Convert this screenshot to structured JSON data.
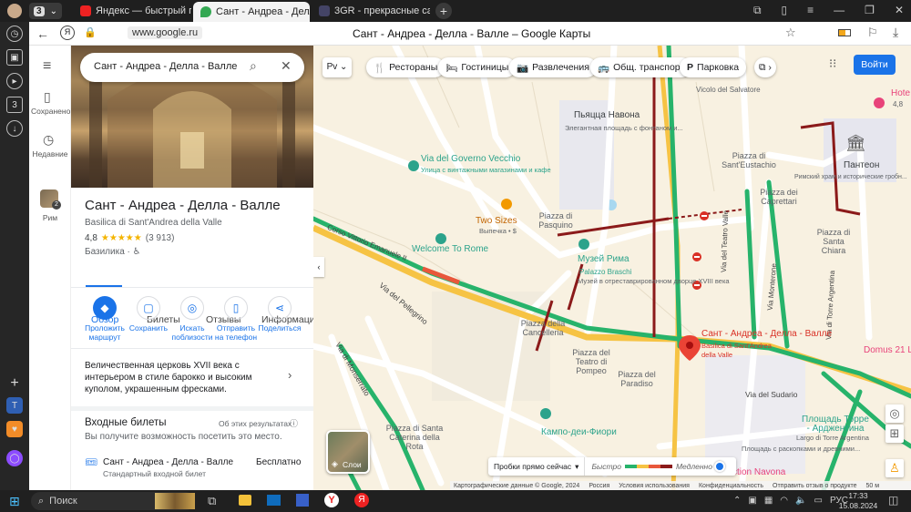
{
  "browser": {
    "tabs": [
      {
        "label": "Яндекс — быстрый поиск"
      },
      {
        "label": "Сант - Андреа - Делла"
      },
      {
        "label": "3GR - прекрасные сады, н"
      }
    ],
    "tab_counter": "3",
    "url": "www.google.ru",
    "page_title": "Сант - Андреа - Делла - Валле – Google Карты"
  },
  "sidebar": {
    "saved_label": "Сохранено",
    "recent_label": "Недавние",
    "rome_label": "Рим",
    "rome_badge": "2"
  },
  "search": {
    "value": "Сант - Андреа - Делла - Валле"
  },
  "place": {
    "title": "Сант - Андреа - Делла - Валле",
    "subtitle": "Basilica di Sant'Andrea della Valle",
    "rating": "4,8",
    "stars": "★★★★★",
    "reviews": "(3 913)",
    "category": "Базилика · ♿",
    "tabs": [
      "Обзор",
      "Билеты",
      "Отзывы",
      "Информация"
    ],
    "actions": [
      {
        "label": "Проложить маршрут",
        "icon": "◆"
      },
      {
        "label": "Сохранить",
        "icon": "▢"
      },
      {
        "label": "Искать поблизости",
        "icon": "◎"
      },
      {
        "label": "Отправить на телефон",
        "icon": "▯"
      },
      {
        "label": "Поделиться",
        "icon": "⋖"
      }
    ],
    "description": "Величественная церковь XVII века с интерьером в стиле барокко и высоким куполом, украшенным фресками.",
    "tickets_title": "Входные билеты",
    "tickets_source": "Об этих результатах",
    "tickets_subtitle": "Вы получите возможность посетить это место.",
    "ticket_name": "Сант - Андреа - Делла - Валле",
    "ticket_price": "Бесплатно",
    "ticket_type": "Стандартный входной билет"
  },
  "map_chips": [
    "Рестораны",
    "Гостиницы",
    "Развлечения",
    "Общ. транспорт",
    "Парковка"
  ],
  "login_label": "Войти",
  "map_labels": {
    "navona": "Пьяцца Навона",
    "navona_desc": "Элегантная площадь с фонтаном и...",
    "governo": "Via del Governo Vecchio",
    "governo_desc": "Улица с винтажными магазинами и кафе",
    "two_sizes": "Two Sizes",
    "two_sizes_desc": "Выпечка • $",
    "pasquino": "Piazza di Pasquino",
    "welcome": "Welcome To Rome",
    "museum": "Музей Рима",
    "palazzo": "Palazzo Braschi",
    "museum_desc": "Музей в отреставрированном дворце XVIII века",
    "corso": "Corso Vittorio Emanuele II",
    "pellegrino": "Via del Pellegrino",
    "cancelleria": "Piazza della Cancelleria",
    "teatro": "Piazza del Teatro di Pompeo",
    "paradiso": "Piazza del Paradiso",
    "campo": "Кампо-деи-Фиори",
    "santa_caterina": "Piazza di Santa Caterina della Rota",
    "monserrato": "Via di Monserrato",
    "salvatore": "Vicolo del Salvatore",
    "eustachio": "Piazza di Sant'Eustachio",
    "capretari": "Piazza dei Caprettari",
    "chiara": "Piazza di Santa Chiara",
    "pantheon": "Пантеон",
    "pantheon_desc": "Римский храм и исторические гробн...",
    "teatro_valle": "Via del Teatro Valle",
    "monterone": "Via Monterone",
    "torre_arg": "Via di Torre Argentina",
    "place_pin": "Сант - Андреа - Делла - Валле",
    "place_pin_sub": "Basilica di Sant'Andrea della Valle",
    "sudario": "Via del Sudario",
    "largo": "Площадь Торре - Арджентина",
    "largo_desc": "Площадь с раскопками и древними...",
    "arenula": "Largo di Torre Argentina",
    "hotel": "Hote",
    "hotel_rating": "4,8",
    "domus": "Domus 21 L",
    "navona_bottom": "ction Navona",
    "layers": "Слои",
    "traffic": "Пробки прямо сейчас",
    "fast": "Быстро",
    "slow": "Медленно"
  },
  "map_footer": [
    "Картографические данные © Google, 2024",
    "Россия",
    "Условия использования",
    "Конфиденциальность",
    "Отправить отзыв о продукте",
    "50 м"
  ],
  "colors": {
    "route_green": "#27b36b",
    "route_red": "#8b1a1a",
    "accent": "#1a73e8",
    "road_yellow": "#f6c344"
  },
  "taskbar": {
    "search_placeholder": "Поиск",
    "lang": "РУС",
    "time": "17:33",
    "date": "15.08.2024"
  }
}
